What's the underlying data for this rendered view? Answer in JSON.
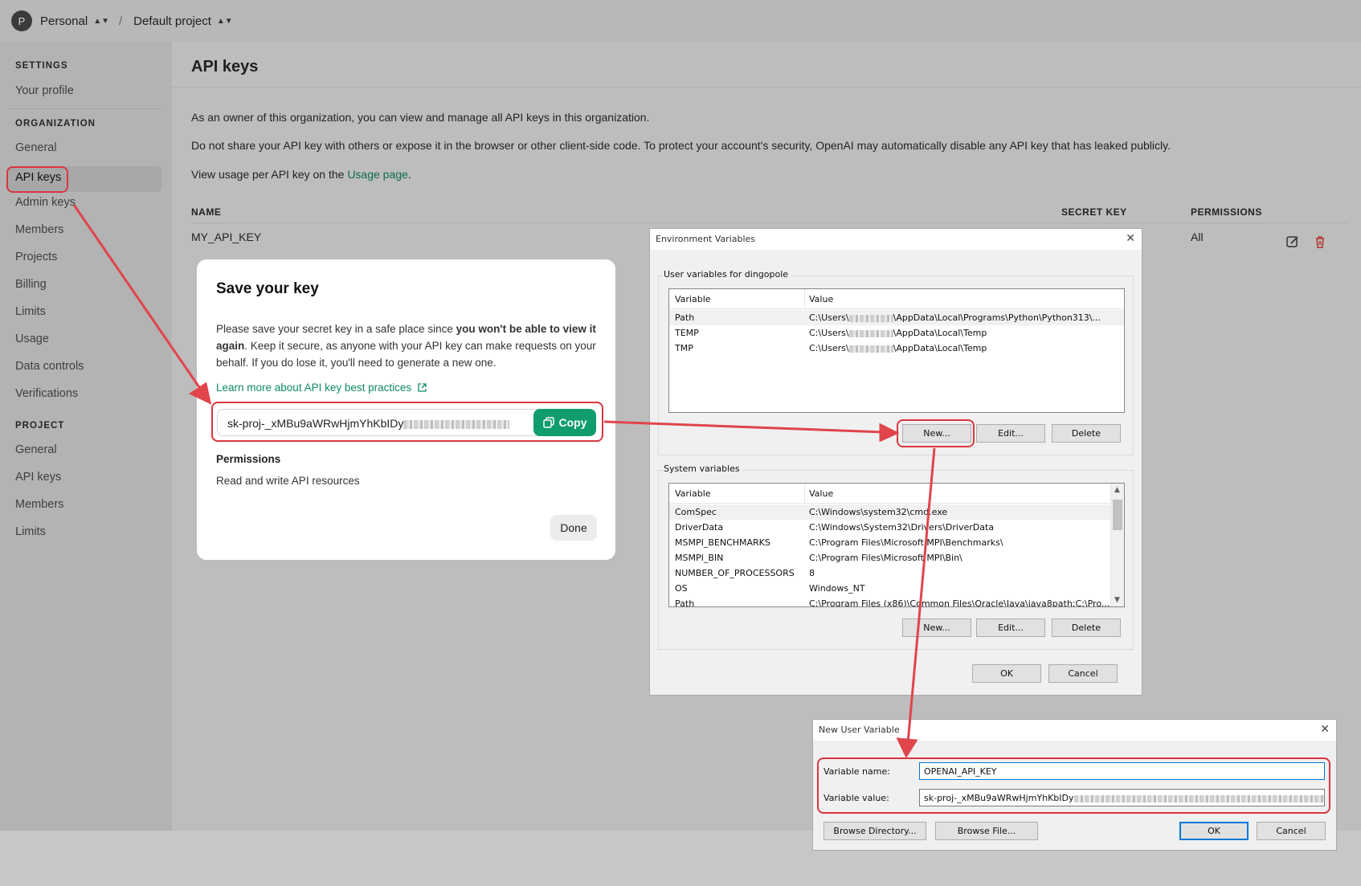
{
  "topbar": {
    "avatar_letter": "P",
    "org": "Personal",
    "separator": "/",
    "project": "Default project"
  },
  "sidebar": {
    "settings_heading": "SETTINGS",
    "settings_items": [
      "Your profile"
    ],
    "organization_heading": "ORGANIZATION",
    "organization_items": [
      "General",
      "API keys",
      "Admin keys",
      "Members",
      "Projects",
      "Billing",
      "Limits",
      "Usage",
      "Data controls",
      "Verifications"
    ],
    "project_heading": "PROJECT",
    "project_items": [
      "General",
      "API keys",
      "Members",
      "Limits"
    ],
    "active_item": "API keys"
  },
  "main": {
    "title": "API keys",
    "para1": "As an owner of this organization, you can view and manage all API keys in this organization.",
    "para2": "Do not share your API key with others or expose it in the browser or other client-side code. To protect your account's security, OpenAI may automatically disable any API key that has leaked publicly.",
    "para3_prefix": "View usage per API key on the ",
    "para3_link": "Usage page",
    "para3_suffix": ".",
    "table": {
      "headers": [
        "NAME",
        "SECRET KEY",
        "PERMISSIONS"
      ],
      "rows": [
        {
          "name": "MY_API_KEY",
          "permissions": "All"
        }
      ]
    }
  },
  "modal": {
    "title": "Save your key",
    "text_part1": "Please save your secret key in a safe place since ",
    "text_bold": "you won't be able to view it again",
    "text_part2": ". Keep it secure, as anyone with your API key can make requests on your behalf. If you do lose it, you'll need to generate a new one.",
    "learn_more": "Learn more about API key best practices",
    "key_value": "sk-proj-_xMBu9aWRwHjmYhKbIDy",
    "copy_label": "Copy",
    "permissions_label": "Permissions",
    "permissions_value": "Read and write API resources",
    "done_label": "Done"
  },
  "env_dialog": {
    "title": "Environment Variables",
    "user_group": "User variables for dingopole",
    "col_variable": "Variable",
    "col_value": "Value",
    "user_vars": [
      {
        "variable": "Path",
        "value_prefix": "C:\\Users\\",
        "value_suffix": "\\AppData\\Local\\Programs\\Python\\Python313\\..."
      },
      {
        "variable": "TEMP",
        "value_prefix": "C:\\Users\\",
        "value_suffix": "\\AppData\\Local\\Temp"
      },
      {
        "variable": "TMP",
        "value_prefix": "C:\\Users\\",
        "value_suffix": "\\AppData\\Local\\Temp"
      }
    ],
    "system_group": "System variables",
    "system_vars": [
      {
        "variable": "ComSpec",
        "value": "C:\\Windows\\system32\\cmd.exe"
      },
      {
        "variable": "DriverData",
        "value": "C:\\Windows\\System32\\Drivers\\DriverData"
      },
      {
        "variable": "MSMPI_BENCHMARKS",
        "value": "C:\\Program Files\\Microsoft MPI\\Benchmarks\\"
      },
      {
        "variable": "MSMPI_BIN",
        "value": "C:\\Program Files\\Microsoft MPI\\Bin\\"
      },
      {
        "variable": "NUMBER_OF_PROCESSORS",
        "value": "8"
      },
      {
        "variable": "OS",
        "value": "Windows_NT"
      },
      {
        "variable": "Path",
        "value": "C:\\Program Files (x86)\\Common Files\\Oracle\\Java\\java8path;C:\\Pro..."
      }
    ],
    "new_label": "New...",
    "edit_label": "Edit...",
    "delete_label": "Delete",
    "ok_label": "OK",
    "cancel_label": "Cancel"
  },
  "new_var_dialog": {
    "title": "New User Variable",
    "name_label": "Variable name:",
    "name_value": "OPENAI_API_KEY",
    "value_label": "Variable value:",
    "value_value": "sk-proj-_xMBu9aWRwHjmYhKbIDy",
    "browse_dir_label": "Browse Directory...",
    "browse_file_label": "Browse File...",
    "ok_label": "OK",
    "cancel_label": "Cancel"
  },
  "colors": {
    "annotation_red": "#d9363e",
    "copy_green": "#0f9d6e",
    "link_green": "#0f8a60"
  }
}
